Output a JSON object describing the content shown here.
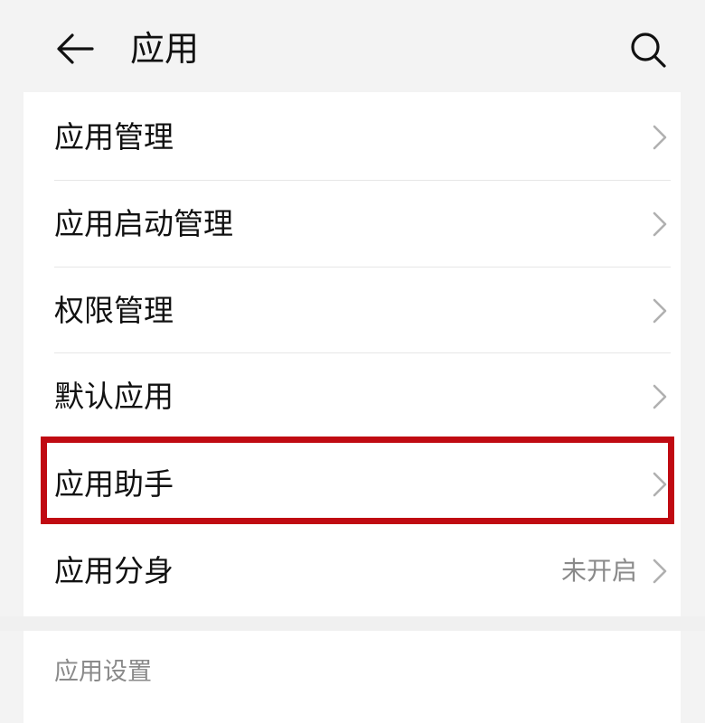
{
  "header": {
    "title": "应用",
    "back_icon": "arrow-left-icon",
    "search_icon": "search-icon"
  },
  "menu": {
    "items": [
      {
        "label": "应用管理"
      },
      {
        "label": "应用启动管理"
      },
      {
        "label": "权限管理"
      },
      {
        "label": "默认应用"
      },
      {
        "label": "应用助手"
      },
      {
        "label": "应用分身",
        "value": "未开启"
      }
    ]
  },
  "section": {
    "title": "应用设置"
  },
  "colors": {
    "background": "#ffffff",
    "header_bg": "#f3f3f3",
    "highlight": "#c00a12",
    "text_primary": "#111111",
    "text_secondary": "#8a8a8a",
    "chevron": "#b0b0b0"
  }
}
